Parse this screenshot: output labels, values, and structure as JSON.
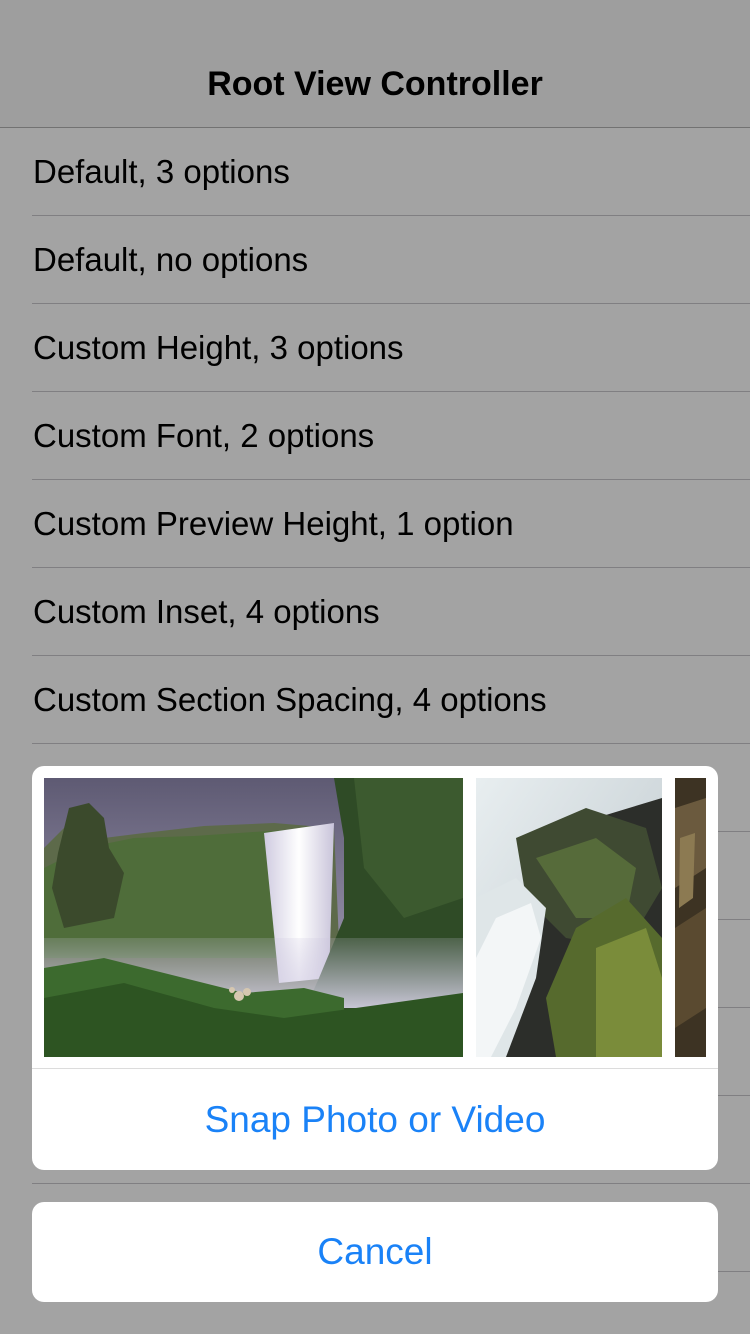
{
  "navbar": {
    "title": "Root View Controller"
  },
  "table": {
    "rows": [
      {
        "label": "Default, 3 options"
      },
      {
        "label": "Default, no options"
      },
      {
        "label": "Custom Height, 3 options"
      },
      {
        "label": "Custom Font, 2 options"
      },
      {
        "label": "Custom Preview Height, 1 option"
      },
      {
        "label": "Custom Inset, 4 options"
      },
      {
        "label": "Custom Section Spacing, 4 options"
      }
    ]
  },
  "action_sheet": {
    "photos": [
      {
        "name": "waterfall-landscape-photo"
      },
      {
        "name": "waterfall-rocks-photo"
      },
      {
        "name": "partial-photo"
      }
    ],
    "primary_action_label": "Snap Photo or Video",
    "cancel_label": "Cancel"
  },
  "colors": {
    "accent": "#1a82f7",
    "overlay": "rgba(0,0,0,0.36)"
  }
}
